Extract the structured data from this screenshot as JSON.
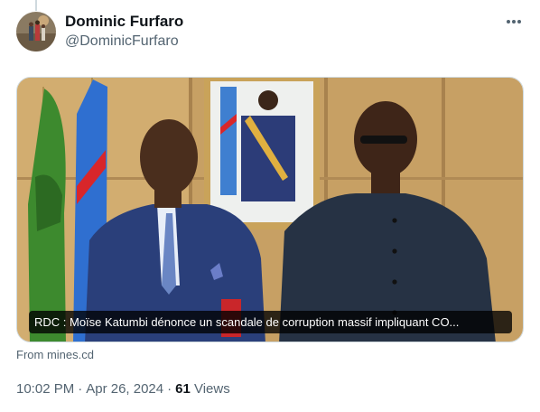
{
  "author": {
    "display_name": "Dominic Furfaro",
    "handle": "@DominicFurfaro"
  },
  "card": {
    "caption": "RDC : Moïse Katumbi dénonce un scandale de corruption massif impliquant CO...",
    "source": "From mines.cd"
  },
  "meta": {
    "time": "10:02 PM",
    "date": "Apr 26, 2024",
    "separator": "·",
    "views_count": "61",
    "views_label": "Views"
  },
  "icons": {
    "more": "more-horizontal-icon"
  }
}
